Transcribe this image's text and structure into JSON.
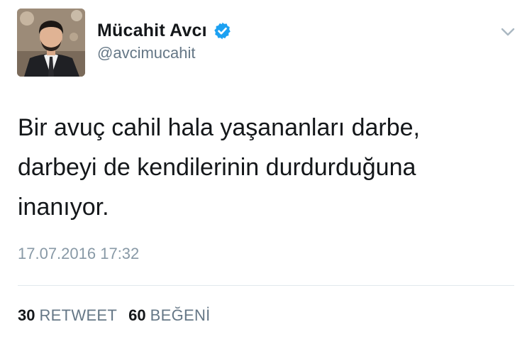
{
  "author": {
    "display_name": "Mücahit Avcı",
    "handle": "@avcimucahit",
    "verified_icon": "verified-badge-icon",
    "avatar_icon": "avatar"
  },
  "menu": {
    "icon": "chevron-down-icon"
  },
  "tweet": {
    "text": "Bir avuç cahil hala yaşananları darbe,\ndarbeyi de kendilerinin durdurduğuna\ninanıyor.",
    "timestamp": "17.07.2016 17:32"
  },
  "stats": {
    "retweets_count": "30",
    "retweets_label": "RETWEET",
    "likes_count": "60",
    "likes_label": "BEĞENİ"
  },
  "colors": {
    "verified_blue": "#1da1f2",
    "text_primary": "#14171a",
    "text_secondary": "#657786",
    "timestamp": "#8899a6",
    "divider": "#e1e8ed"
  }
}
